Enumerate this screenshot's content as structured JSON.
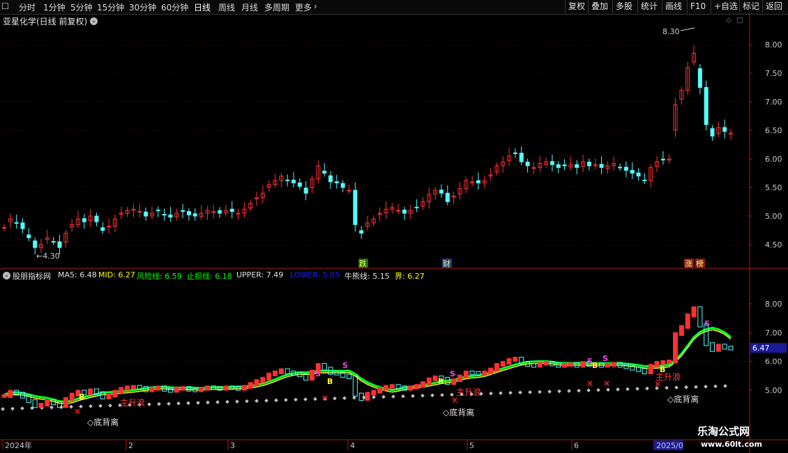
{
  "toolbar": {
    "periods": [
      "分时",
      "1分钟",
      "5分钟",
      "15分钟",
      "30分钟",
      "60分钟",
      "日线",
      "周线",
      "月线",
      "多周期",
      "更多"
    ],
    "active_period": "日线",
    "right_buttons": [
      "复权",
      "叠加",
      "多股",
      "统计",
      "画线",
      "F10",
      "+自选",
      "返回"
    ]
  },
  "stock": {
    "title": "亚星化学(日线 前复权)"
  },
  "main_chart": {
    "price_axis": [
      "8.00",
      "7.50",
      "7.00",
      "6.50",
      "6.00",
      "5.50",
      "5.00",
      "4.50"
    ],
    "max_label": "8.30",
    "min_label": "4.30",
    "event_tags": [
      "跌",
      "财",
      "涨",
      "榜"
    ]
  },
  "indicator": {
    "name": "股朋指标网",
    "values": [
      {
        "label": "MA5: 6.48",
        "color": "#e0e0e0"
      },
      {
        "label": "MID: 6.27",
        "color": "#ffff00"
      },
      {
        "label": "风险线: 6.59",
        "color": "#00ff00"
      },
      {
        "label": "止损线: 6.18",
        "color": "#00ff00"
      },
      {
        "label": "UPPER: 7.49",
        "color": "#e0e0e0"
      },
      {
        "label": "LOWER: 5.05",
        "color": "#2020ff"
      },
      {
        "label": "牛熊线: 5.15",
        "color": "#e0e0e0"
      },
      {
        "label": "界: 6.27",
        "color": "#ffff00"
      }
    ],
    "axis": [
      "8.00",
      "7.00",
      "6.00",
      "5.00"
    ],
    "current_value": "6.47",
    "divergence_label": "◇底背离",
    "wave_label": "主升浪",
    "signals": {
      "buy": "B",
      "sell": "S"
    }
  },
  "date_axis": [
    "2024年",
    "2",
    "3",
    "4",
    "5",
    "6",
    "2025/0"
  ],
  "watermark": {
    "line1": "乐淘公式网",
    "line2": "www.60lt.com"
  },
  "colors": {
    "up": "#ff3030",
    "down": "#54ffff",
    "grid": "#7a1010",
    "axis": "#b01818"
  }
}
